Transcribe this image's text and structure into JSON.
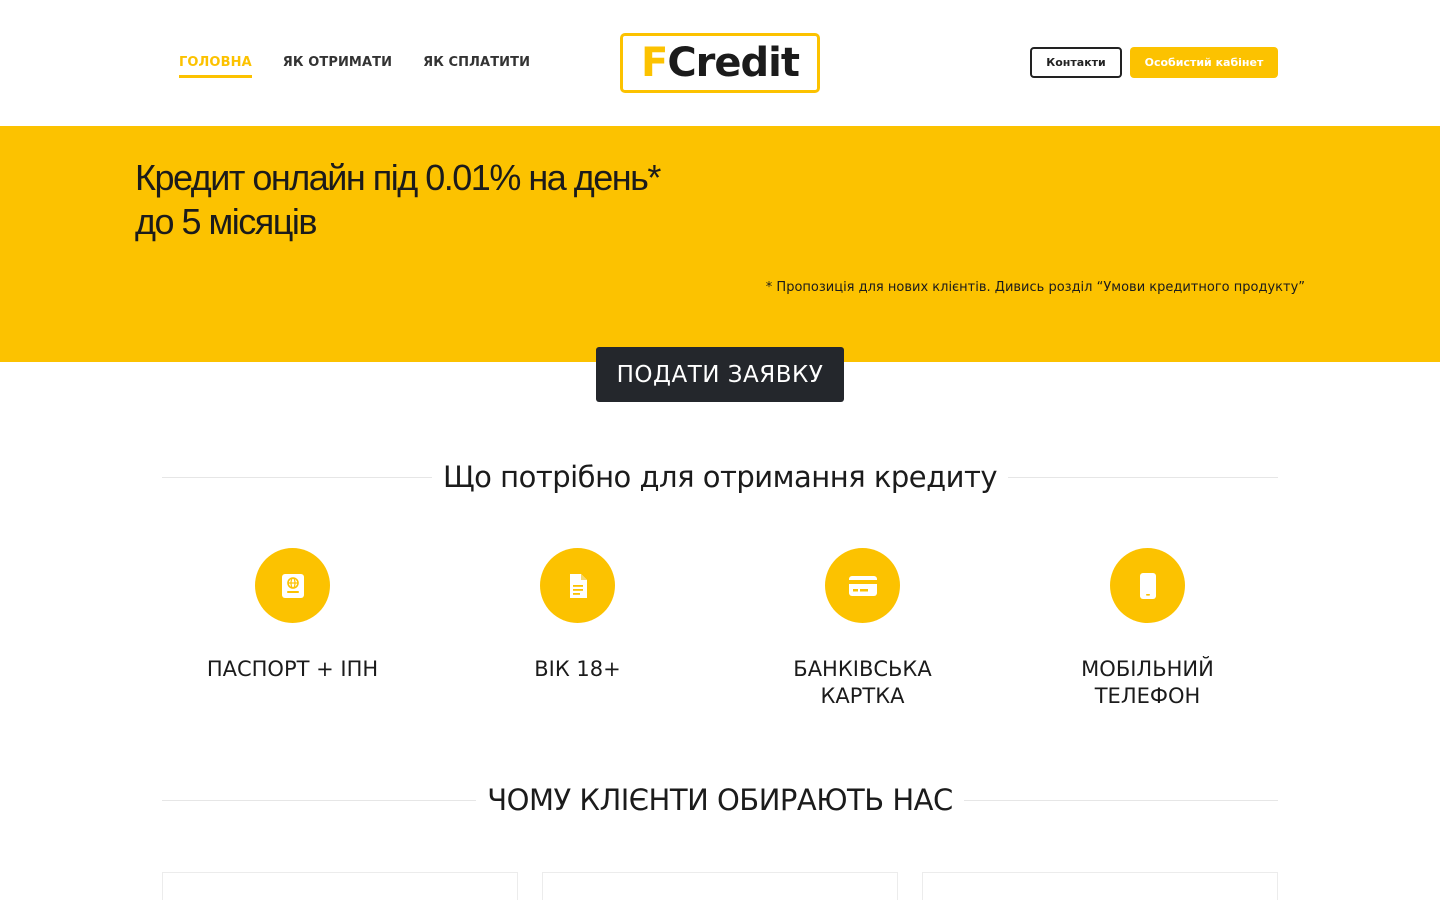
{
  "header": {
    "nav": [
      {
        "label": "ГОЛОВНА",
        "active": true
      },
      {
        "label": "ЯК ОТРИМАТИ",
        "active": false
      },
      {
        "label": "ЯК СПЛАТИТИ",
        "active": false
      }
    ],
    "logo": {
      "first": "F",
      "rest": "Credit"
    },
    "contacts_label": "Контакти",
    "cabinet_label": "Особистий кабінет"
  },
  "hero": {
    "title_line1": "Кредит онлайн під 0.01% на день*",
    "title_line2": "до 5 місяців",
    "note": "* Пропозиція для нових клієнтів. Дивись розділ “Умови кредитного продукту”",
    "apply_label": "ПОДАТИ ЗАЯВКУ"
  },
  "requirements": {
    "title": "Що потрібно для отримання кредиту",
    "items": [
      {
        "icon": "passport-icon",
        "line1": "ПАСПОРТ + ІПН",
        "line2": ""
      },
      {
        "icon": "document-icon",
        "line1": "ВІК 18+",
        "line2": ""
      },
      {
        "icon": "credit-card-icon",
        "line1": "БАНКІВСЬКА",
        "line2": "КАРТКА"
      },
      {
        "icon": "mobile-phone-icon",
        "line1": "МОБІЛЬНИЙ",
        "line2": "ТЕЛЕФОН"
      }
    ]
  },
  "why": {
    "title": "ЧОМУ КЛІЄНТИ ОБИРАЮТЬ НАС"
  },
  "colors": {
    "accent": "#fcc200",
    "dark": "#24272c",
    "text": "#1b1b1b"
  }
}
